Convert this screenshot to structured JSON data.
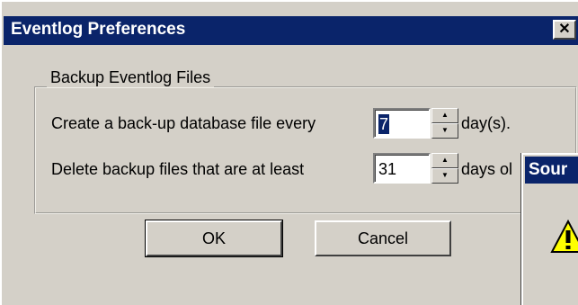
{
  "window": {
    "title": "Eventlog Preferences",
    "close_glyph": "✕"
  },
  "group": {
    "title": "Backup Eventlog Files"
  },
  "rows": [
    {
      "label": "Create a back-up database file every",
      "value": "7",
      "suffix": "day(s)."
    },
    {
      "label": "Delete backup files that are at least",
      "value": "31",
      "suffix": "days ol"
    }
  ],
  "spinner": {
    "up_glyph": "▲",
    "down_glyph": "▼"
  },
  "buttons": {
    "ok": "OK",
    "cancel": "Cancel"
  },
  "overlay_dialog": {
    "title_partial": "Sour",
    "icon": "warning-icon"
  },
  "colors": {
    "titlebar": "#0a246a",
    "face": "#d4d0c8",
    "selection": "#0a246a"
  }
}
